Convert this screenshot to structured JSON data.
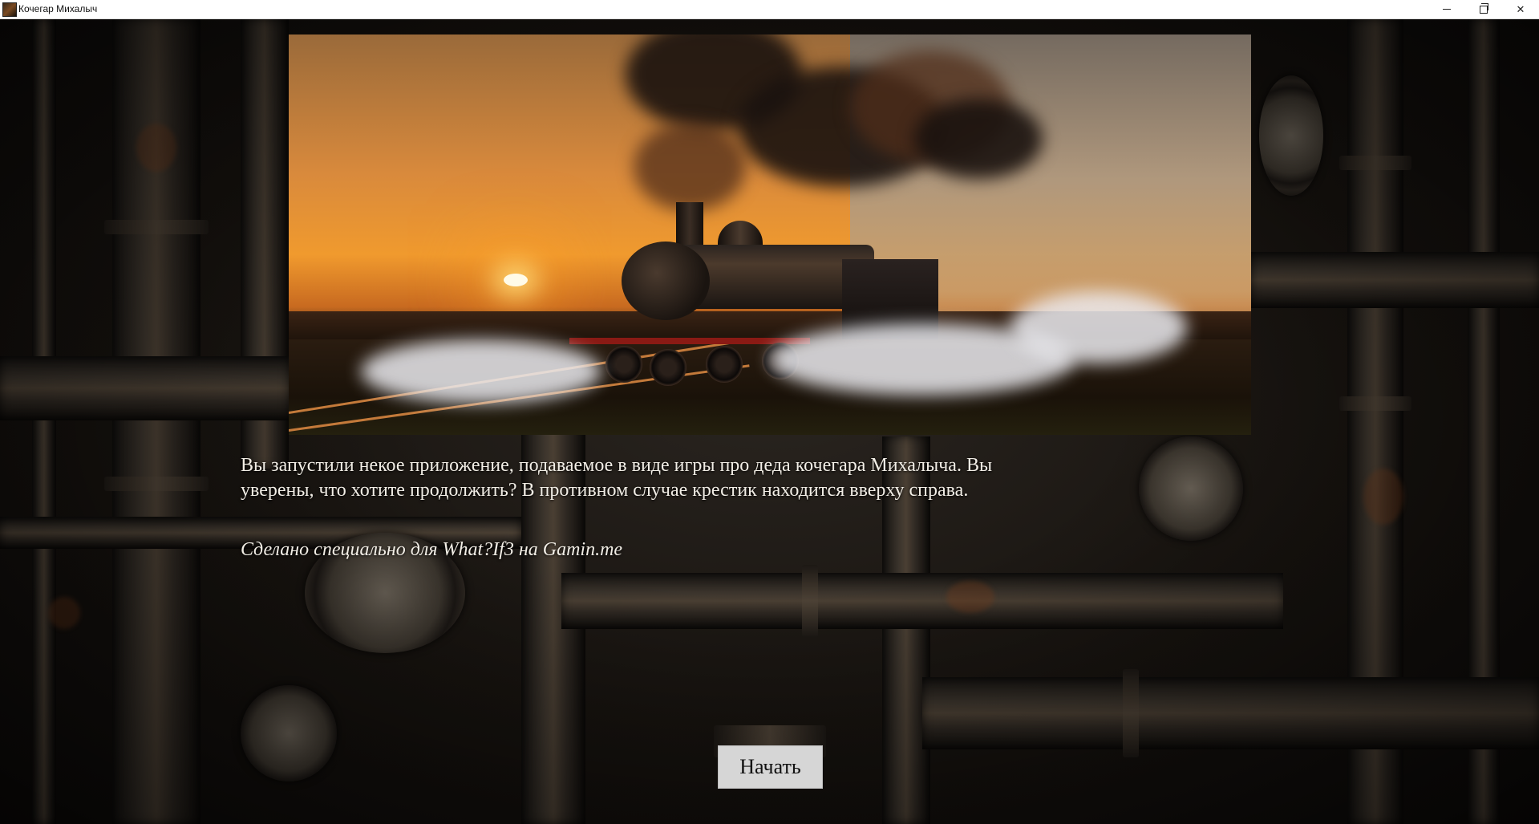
{
  "window": {
    "title": "Кочегар Михалыч",
    "controls": [
      "minimize",
      "maximize",
      "close"
    ]
  },
  "scene": {
    "background_theme": "dark rusty industrial pipes with pressure gauges",
    "hero_image": "steam locomotive at sunset with smoke"
  },
  "intro": {
    "text": "Вы запустили некое приложение, подаваемое в виде игры про деда кочегара Михалыча. Вы уверены, что хотите продолжить? В противном случае крестик находится вверху справа.",
    "credits": "Сделано специально для What?If3 на Gamin.me"
  },
  "actions": {
    "start_label": "Начать"
  },
  "colors": {
    "text": "#f2eee6",
    "button_bg": "#d6d6d6",
    "sunset_orange": "#f09a2e"
  }
}
